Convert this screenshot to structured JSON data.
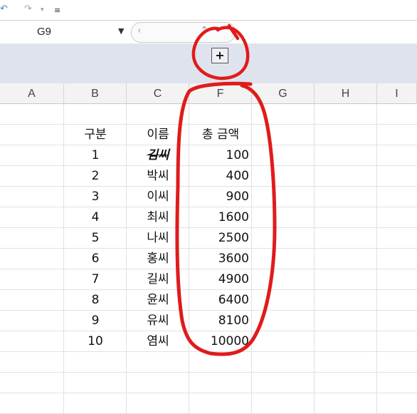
{
  "toolbar": {
    "undo_icon": "undo-icon",
    "redo_icon": "redo-icon",
    "more_icon": "customize-icon"
  },
  "namebox": {
    "value": "G9"
  },
  "formula_bar": {
    "collapse_glyph": "‹",
    "expand_glyph": "⌃"
  },
  "outline": {
    "expand_label": "+"
  },
  "columns": [
    "A",
    "B",
    "C",
    "F",
    "G",
    "H",
    "I"
  ],
  "headers": {
    "b": "구분",
    "c": "이름",
    "f": "총 금액"
  },
  "rows": [
    {
      "b": "1",
      "c": "김씨",
      "f": "100"
    },
    {
      "b": "2",
      "c": "박씨",
      "f": "400"
    },
    {
      "b": "3",
      "c": "이씨",
      "f": "900"
    },
    {
      "b": "4",
      "c": "최씨",
      "f": "1600"
    },
    {
      "b": "5",
      "c": "나씨",
      "f": "2500"
    },
    {
      "b": "6",
      "c": "홍씨",
      "f": "3600"
    },
    {
      "b": "7",
      "c": "길씨",
      "f": "4900"
    },
    {
      "b": "8",
      "c": "윤씨",
      "f": "6400"
    },
    {
      "b": "9",
      "c": "유씨",
      "f": "8100"
    },
    {
      "b": "10",
      "c": "염씨",
      "f": "10000"
    }
  ],
  "colors": {
    "annotation": "#e01b1b",
    "outline_bar": "#dfe3ee",
    "header_bg": "#f3f3f3"
  }
}
